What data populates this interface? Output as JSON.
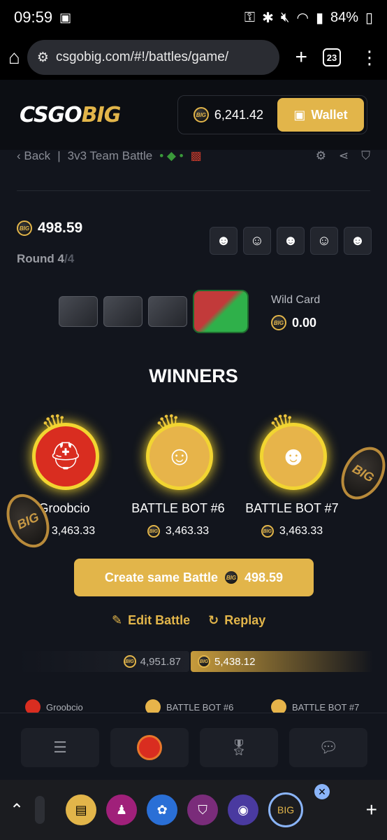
{
  "status_bar": {
    "time": "09:59",
    "battery": "84%"
  },
  "browser": {
    "url": "csgobig.com/#!/battles/game/",
    "tab_count": "23"
  },
  "header": {
    "logo_cs": "CSGO",
    "logo_big": "BIG",
    "balance": "6,241.42",
    "wallet_label": "Wallet"
  },
  "breadcrumb": {
    "back": "Back",
    "title": "3v3 Team Battle"
  },
  "battle": {
    "cost": "498.59",
    "round_label": "Round 4",
    "round_total": "/4"
  },
  "wild_card": {
    "label": "Wild Card",
    "value": "0.00"
  },
  "winners": {
    "title": "WINNERS",
    "items": [
      {
        "name": "Groobcio",
        "amount": "3,463.33"
      },
      {
        "name": "BATTLE BOT #6",
        "amount": "3,463.33"
      },
      {
        "name": "BATTLE BOT #7",
        "amount": "3,463.33"
      }
    ]
  },
  "actions": {
    "create_label": "Create same Battle",
    "create_price": "498.59",
    "edit_label": "Edit Battle",
    "replay_label": "Replay"
  },
  "tally": {
    "left": "4,951.87",
    "right": "5,438.12"
  },
  "players": [
    "Groobcio",
    "BATTLE BOT #6",
    "BATTLE BOT #7"
  ],
  "colors": {
    "accent": "#e2b54a",
    "background": "#12151d"
  }
}
